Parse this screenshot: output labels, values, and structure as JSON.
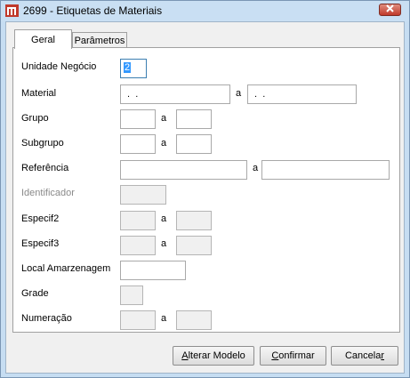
{
  "window": {
    "title": "2699 - Etiquetas de Materiais",
    "icon": "app-logo-icon",
    "close_icon": "close-icon"
  },
  "tabs": [
    {
      "label": "Geral",
      "active": true
    },
    {
      "label": "Parâmetros",
      "active": false
    }
  ],
  "form": {
    "unidade_negocio": {
      "label": "Unidade Negócio",
      "value": "2"
    },
    "material": {
      "label": "Material",
      "from_value": " .  .",
      "sep": "a",
      "to_value": " .  ."
    },
    "grupo": {
      "label": "Grupo",
      "sep": "a"
    },
    "subgrupo": {
      "label": "Subgrupo",
      "sep": "a"
    },
    "referencia": {
      "label": "Referência",
      "sep": "a"
    },
    "identificador": {
      "label": "Identificador"
    },
    "especif2": {
      "label": "Especif2",
      "sep": "a"
    },
    "especif3": {
      "label": "Especif3",
      "sep": "a"
    },
    "local_armazenagem": {
      "label": "Local Amarzenagem"
    },
    "grade": {
      "label": "Grade"
    },
    "numeracao": {
      "label": "Numeração",
      "sep": "a"
    }
  },
  "buttons": {
    "alterar_modelo": {
      "underline": "A",
      "rest": "lterar Modelo"
    },
    "confirmar": {
      "underline": "C",
      "rest": "onfirmar"
    },
    "cancelar_pre": "Cancela",
    "cancelar_underline": "r"
  },
  "colors": {
    "title_bg": "#c9dff3",
    "close_button": "#c0392b",
    "selection": "#3399ff"
  }
}
